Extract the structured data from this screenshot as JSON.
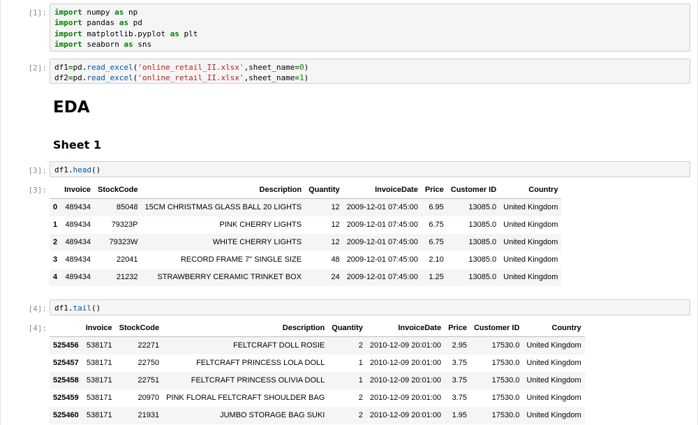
{
  "cells": [
    {
      "prompt": "[1]:",
      "lines": [
        "import numpy as np",
        "import pandas as pd",
        "import matplotlib.pyplot as plt",
        "import seaborn as sns"
      ]
    },
    {
      "prompt": "[2]:",
      "lines": [
        "df1=pd.read_excel('online_retail_II.xlsx',sheet_name=0)",
        "df2=pd.read_excel('online_retail_II.xlsx',sheet_name=1)"
      ]
    },
    {
      "prompt": "[3]:",
      "code": "df1.head()",
      "out_prompt": "[3]:"
    },
    {
      "prompt": "[4]:",
      "code": "df1.tail()",
      "out_prompt": "[4]:"
    }
  ],
  "markdown": {
    "h1": "EDA",
    "h2": "Sheet 1"
  },
  "head_table": {
    "columns": [
      "",
      "Invoice",
      "StockCode",
      "Description",
      "Quantity",
      "InvoiceDate",
      "Price",
      "Customer ID",
      "Country"
    ],
    "rows": [
      [
        "0",
        "489434",
        "85048",
        "15CM CHRISTMAS GLASS BALL 20 LIGHTS",
        "12",
        "2009-12-01 07:45:00",
        "6.95",
        "13085.0",
        "United Kingdom"
      ],
      [
        "1",
        "489434",
        "79323P",
        "PINK CHERRY LIGHTS",
        "12",
        "2009-12-01 07:45:00",
        "6.75",
        "13085.0",
        "United Kingdom"
      ],
      [
        "2",
        "489434",
        "79323W",
        "WHITE CHERRY LIGHTS",
        "12",
        "2009-12-01 07:45:00",
        "6.75",
        "13085.0",
        "United Kingdom"
      ],
      [
        "3",
        "489434",
        "22041",
        "RECORD FRAME 7\" SINGLE SIZE",
        "48",
        "2009-12-01 07:45:00",
        "2.10",
        "13085.0",
        "United Kingdom"
      ],
      [
        "4",
        "489434",
        "21232",
        "STRAWBERRY CERAMIC TRINKET BOX",
        "24",
        "2009-12-01 07:45:00",
        "1.25",
        "13085.0",
        "United Kingdom"
      ]
    ]
  },
  "tail_table": {
    "columns": [
      "",
      "Invoice",
      "StockCode",
      "Description",
      "Quantity",
      "InvoiceDate",
      "Price",
      "Customer ID",
      "Country"
    ],
    "rows": [
      [
        "525456",
        "538171",
        "22271",
        "FELTCRAFT DOLL ROSIE",
        "2",
        "2010-12-09 20:01:00",
        "2.95",
        "17530.0",
        "United Kingdom"
      ],
      [
        "525457",
        "538171",
        "22750",
        "FELTCRAFT PRINCESS LOLA DOLL",
        "1",
        "2010-12-09 20:01:00",
        "3.75",
        "17530.0",
        "United Kingdom"
      ],
      [
        "525458",
        "538171",
        "22751",
        "FELTCRAFT PRINCESS OLIVIA DOLL",
        "1",
        "2010-12-09 20:01:00",
        "3.75",
        "17530.0",
        "United Kingdom"
      ],
      [
        "525459",
        "538171",
        "20970",
        "PINK FLORAL FELTCRAFT SHOULDER BAG",
        "2",
        "2010-12-09 20:01:00",
        "3.75",
        "17530.0",
        "United Kingdom"
      ],
      [
        "525460",
        "538171",
        "21931",
        "JUMBO STORAGE BAG SUKI",
        "2",
        "2010-12-09 20:01:00",
        "1.95",
        "17530.0",
        "United Kingdom"
      ]
    ]
  }
}
